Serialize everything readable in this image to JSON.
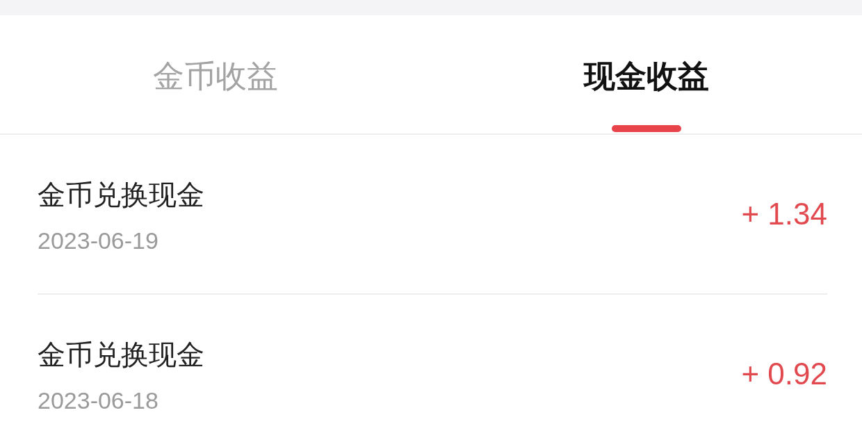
{
  "tabs": [
    {
      "label": "金币收益",
      "selected": false
    },
    {
      "label": "现金收益",
      "selected": true
    }
  ],
  "records": [
    {
      "title": "金币兑换现金",
      "date": "2023-06-19",
      "amount": "+ 1.34"
    },
    {
      "title": "金币兑换现金",
      "date": "2023-06-18",
      "amount": "+ 0.92"
    }
  ]
}
